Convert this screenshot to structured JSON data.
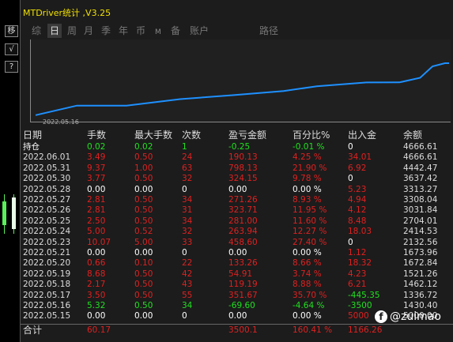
{
  "sidebar": {
    "buttons": [
      {
        "label": "移",
        "icon": "move-icon"
      },
      {
        "label": "√",
        "icon": "check-icon"
      },
      {
        "label": "?",
        "icon": "help-icon"
      }
    ]
  },
  "titlebar": {
    "text": "MTDriver统计 ,V3.25"
  },
  "tabs": [
    {
      "label": "综",
      "selected": false
    },
    {
      "label": "日",
      "selected": true
    },
    {
      "label": "周",
      "selected": false
    },
    {
      "label": "月",
      "selected": false
    },
    {
      "label": "季",
      "selected": false
    },
    {
      "label": "年",
      "selected": false
    },
    {
      "label": "币",
      "selected": false
    },
    {
      "label": "M",
      "selected": false
    },
    {
      "label": "备",
      "selected": false
    },
    {
      "label": "账户",
      "selected": false
    },
    {
      "label": "路径",
      "selected": false
    }
  ],
  "chart": {
    "x_label": "2022.05.16"
  },
  "chart_data": {
    "type": "line",
    "series": [
      {
        "values": [
          1000.0,
          1672.84,
          1673.96,
          2132.56,
          2414.53,
          2704.01,
          3031.84,
          3308.04,
          3313.27,
          3637.42,
          4442.47,
          4666.61,
          4666.61
        ]
      }
    ],
    "line_color": "#1e90ff"
  },
  "table": {
    "headers": [
      "日期",
      "手数",
      "最大手数",
      "次数",
      "盈亏金额",
      "百分比%",
      "出入金",
      "余额"
    ],
    "rows": [
      {
        "date": "持仓",
        "lots": "0.02",
        "max": "0.02",
        "count": "1",
        "pnl": "-0.25",
        "pct": "-0.01 %",
        "io": "0",
        "bal": "4666.61",
        "color": "#20e020",
        "io_color": "#ffffff"
      },
      {
        "date": "2022.06.01",
        "lots": "3.49",
        "max": "0.50",
        "count": "24",
        "pnl": "190.13",
        "pct": "4.25 %",
        "io": "34.01",
        "bal": "4666.61",
        "color": "#e02020",
        "io_color": "#e02020"
      },
      {
        "date": "2022.05.31",
        "lots": "9.37",
        "max": "1.00",
        "count": "63",
        "pnl": "798.13",
        "pct": "21.90 %",
        "io": "6.92",
        "bal": "4442.47",
        "color": "#e02020",
        "io_color": "#e02020"
      },
      {
        "date": "2022.05.30",
        "lots": "3.77",
        "max": "0.50",
        "count": "32",
        "pnl": "324.15",
        "pct": "9.78 %",
        "io": "0",
        "bal": "3637.42",
        "color": "#e02020",
        "io_color": "#ffffff"
      },
      {
        "date": "2022.05.28",
        "lots": "0.00",
        "max": "0.00",
        "count": "0",
        "pnl": "0.00",
        "pct": "0.00 %",
        "io": "5.23",
        "bal": "3313.27",
        "color": "#ffffff",
        "io_color": "#e02020"
      },
      {
        "date": "2022.05.27",
        "lots": "2.81",
        "max": "0.50",
        "count": "34",
        "pnl": "271.26",
        "pct": "8.93 %",
        "io": "4.94",
        "bal": "3308.04",
        "color": "#e02020",
        "io_color": "#e02020"
      },
      {
        "date": "2022.05.26",
        "lots": "2.81",
        "max": "0.50",
        "count": "31",
        "pnl": "323.71",
        "pct": "11.95 %",
        "io": "4.12",
        "bal": "3031.84",
        "color": "#e02020",
        "io_color": "#e02020"
      },
      {
        "date": "2022.05.25",
        "lots": "2.50",
        "max": "0.50",
        "count": "34",
        "pnl": "281.00",
        "pct": "11.60 %",
        "io": "8.48",
        "bal": "2704.01",
        "color": "#e02020",
        "io_color": "#e02020"
      },
      {
        "date": "2022.05.24",
        "lots": "5.00",
        "max": "0.52",
        "count": "32",
        "pnl": "263.94",
        "pct": "12.27 %",
        "io": "18.03",
        "bal": "2414.53",
        "color": "#e02020",
        "io_color": "#e02020"
      },
      {
        "date": "2022.05.23",
        "lots": "10.07",
        "max": "5.00",
        "count": "33",
        "pnl": "458.60",
        "pct": "27.40 %",
        "io": "0",
        "bal": "2132.56",
        "color": "#e02020",
        "io_color": "#ffffff"
      },
      {
        "date": "2022.05.21",
        "lots": "0.00",
        "max": "0.00",
        "count": "0",
        "pnl": "0.00",
        "pct": "0.00 %",
        "io": "1.12",
        "bal": "1673.96",
        "color": "#ffffff",
        "io_color": "#e02020"
      },
      {
        "date": "2022.05.20",
        "lots": "0.66",
        "max": "0.10",
        "count": "22",
        "pnl": "133.26",
        "pct": "8.66 %",
        "io": "18.32",
        "bal": "1672.84",
        "color": "#e02020",
        "io_color": "#e02020"
      },
      {
        "date": "2022.05.19",
        "lots": "8.68",
        "max": "0.50",
        "count": "42",
        "pnl": "54.91",
        "pct": "3.74 %",
        "io": "4.23",
        "bal": "1521.26",
        "color": "#e02020",
        "io_color": "#e02020"
      },
      {
        "date": "2022.05.18",
        "lots": "2.17",
        "max": "0.50",
        "count": "43",
        "pnl": "119.19",
        "pct": "8.88 %",
        "io": "6.21",
        "bal": "1462.12",
        "color": "#e02020",
        "io_color": "#e02020"
      },
      {
        "date": "2022.05.17",
        "lots": "3.50",
        "max": "0.50",
        "count": "55",
        "pnl": "351.67",
        "pct": "35.70 %",
        "io": "-445.35",
        "bal": "1336.72",
        "color": "#e02020",
        "io_color": "#20e020"
      },
      {
        "date": "2022.05.16",
        "lots": "5.32",
        "max": "0.50",
        "count": "34",
        "pnl": "-69.60",
        "pct": "-4.64 %",
        "io": "-3500",
        "bal": "1430.40",
        "color": "#20e020",
        "io_color": "#20e020"
      },
      {
        "date": "2022.05.15",
        "lots": "0.00",
        "max": "0.00",
        "count": "0",
        "pnl": "0.00",
        "pct": "0.00 %",
        "io": "5000",
        "bal": "5000.00",
        "color": "#ffffff",
        "io_color": "#e02020"
      }
    ],
    "summary": {
      "label": "合计",
      "lots": "60.17",
      "pnl": "3500.1",
      "pct": "160.41 %",
      "io": "1166.26",
      "color": "#e02020"
    }
  },
  "watermark": {
    "text": "@zuimao",
    "icon": "social-icon"
  }
}
